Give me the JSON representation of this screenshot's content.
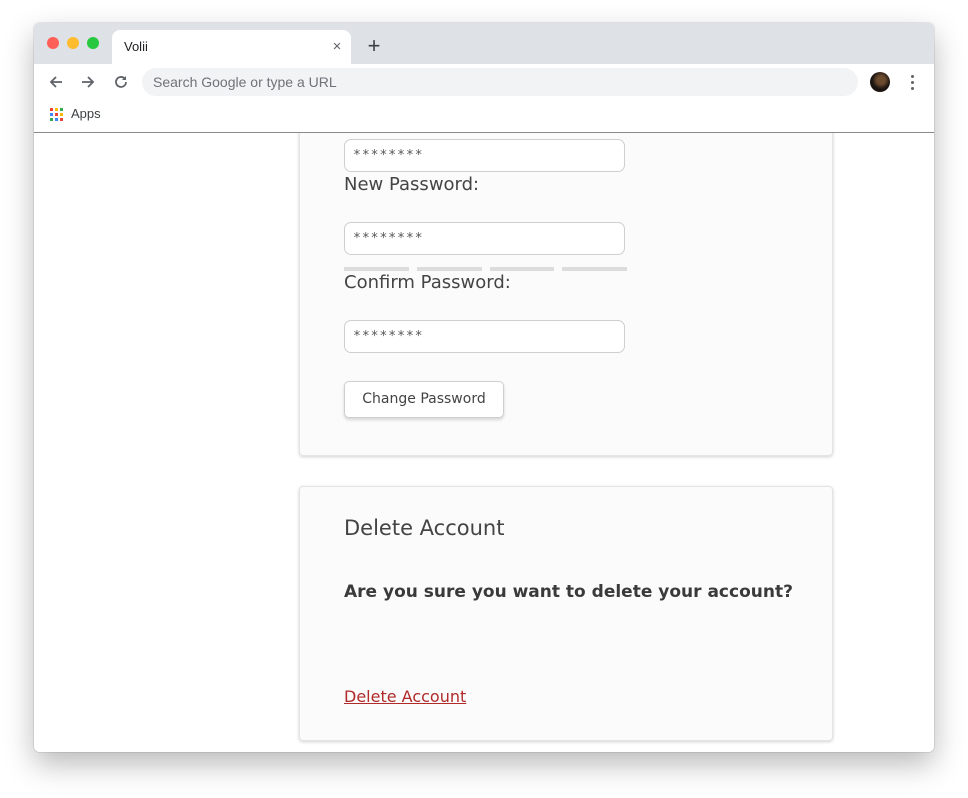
{
  "browser": {
    "tab_title": "Volii",
    "tab_close_glyph": "×",
    "new_tab_glyph": "+",
    "address_placeholder": "Search Google or type a URL",
    "bookmarks": {
      "apps_label": "Apps"
    },
    "icons": [
      "back-arrow-icon",
      "forward-arrow-icon",
      "reload-icon",
      "profile-avatar",
      "more-vert-icon",
      "apps-grid-icon"
    ]
  },
  "password_card": {
    "current_password_value": "********",
    "new_password_label": "New Password:",
    "new_password_value": "********",
    "strength_meter": {
      "segments": 4,
      "filled": 0
    },
    "confirm_password_label": "Confirm Password:",
    "confirm_password_value": "********",
    "change_button_label": "Change Password"
  },
  "delete_card": {
    "title": "Delete Account",
    "question": "Are you sure you want to delete your account?",
    "delete_link_label": "Delete Account"
  },
  "colors": {
    "delete_link": "#b02a2a",
    "card_background": "#fbfbfb",
    "tabbar_background": "#dee1e6"
  }
}
